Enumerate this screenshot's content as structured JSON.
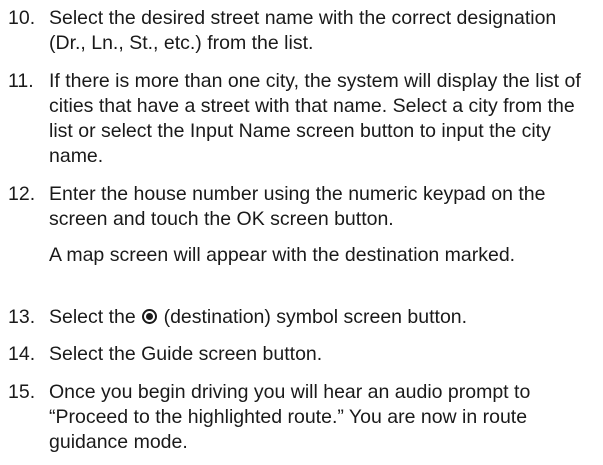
{
  "steps": [
    {
      "number": "10.",
      "text": "Select the desired street name with the correct designation (Dr., Ln., St., etc.) from the list."
    },
    {
      "number": "11.",
      "text": "If there is more than one city, the system will display the list of cities that have a street with that name. Select a city from the list or select the Input Name screen button to input the city name."
    },
    {
      "number": "12.",
      "text": "Enter the house number using the numeric keypad on the screen and touch the OK screen button."
    },
    {
      "note": "A map screen will appear with the destination marked."
    },
    {
      "number": "13.",
      "text_before": "Select the",
      "icon": "destination-symbol-icon",
      "text_after": "(destination) symbol screen button."
    },
    {
      "number": "14.",
      "text": "Select the Guide screen button."
    },
    {
      "number": "15.",
      "text": "Once you begin driving you will hear an audio prompt to “Proceed to the highlighted route.” You are now in route guidance mode."
    }
  ]
}
